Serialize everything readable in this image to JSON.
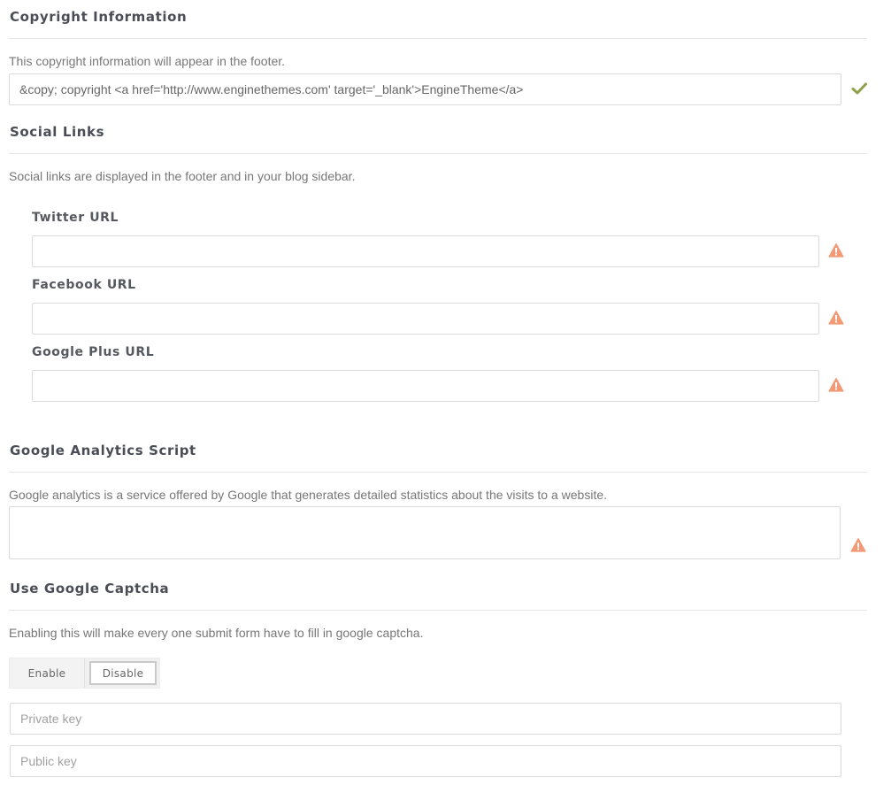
{
  "copyright": {
    "title": "Copyright Information",
    "description": "This copyright information will appear in the footer.",
    "value": "&copy; copyright <a href='http://www.enginethemes.com' target='_blank'>EngineTheme</a>",
    "status_icon": "checkmark-icon",
    "status_color": "#8ea04a"
  },
  "social": {
    "title": "Social Links",
    "description": "Social links are displayed in the footer and in your blog sidebar.",
    "twitter": {
      "label": "Twitter URL",
      "value": ""
    },
    "facebook": {
      "label": "Facebook URL",
      "value": ""
    },
    "googleplus": {
      "label": "Google Plus URL",
      "value": ""
    },
    "warning_icon": "warning-icon",
    "warning_color": "#f29a76"
  },
  "analytics": {
    "title": "Google Analytics Script",
    "description": "Google analytics is a service offered by Google that generates detailed statistics about the visits to a website.",
    "value": ""
  },
  "captcha": {
    "title": "Use Google Captcha",
    "description": "Enabling this will make every one submit form have to fill in google captcha.",
    "enable_label": "Enable",
    "disable_label": "Disable",
    "selected": "Disable",
    "private_key_placeholder": "Private key",
    "public_key_placeholder": "Public key"
  }
}
